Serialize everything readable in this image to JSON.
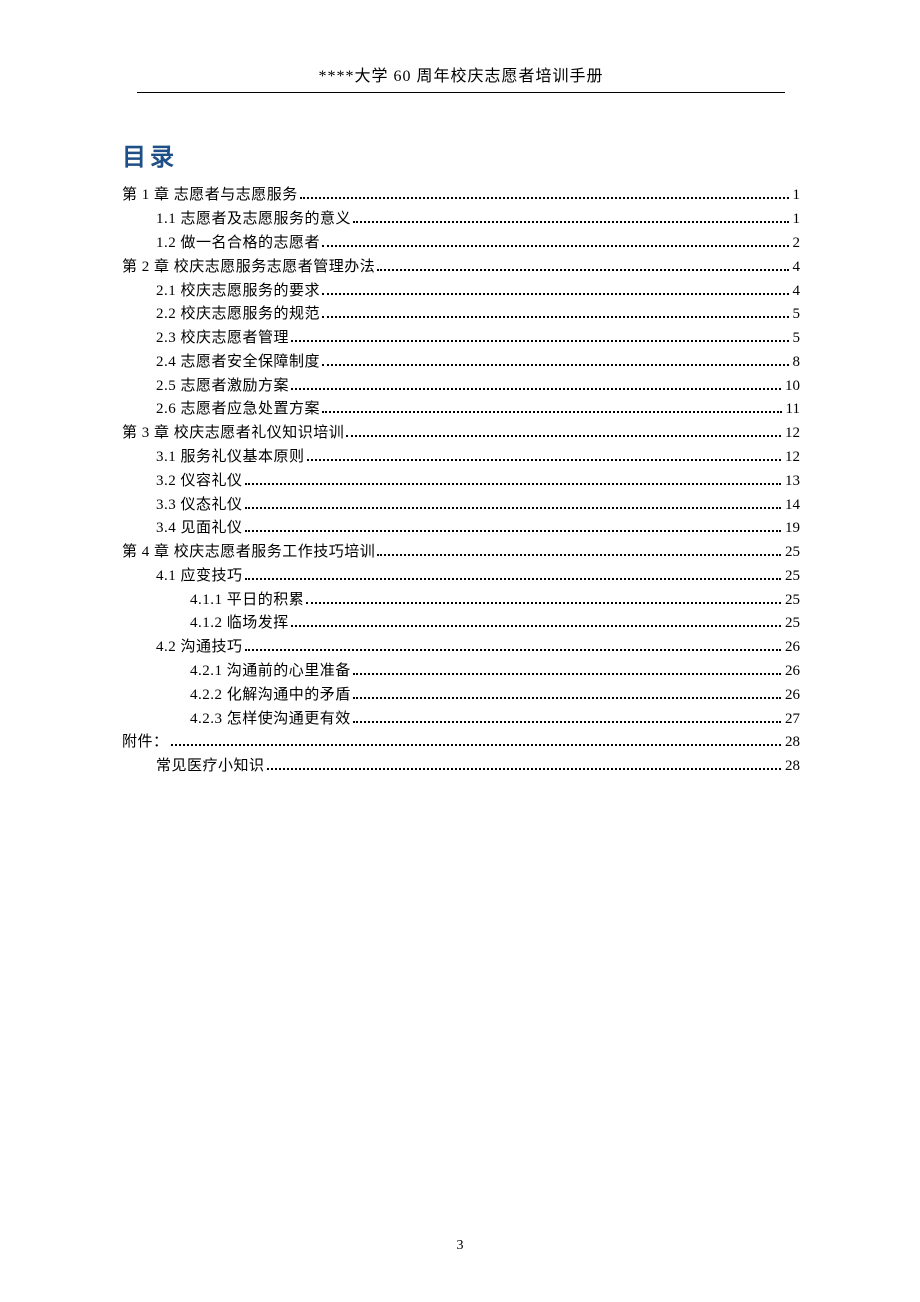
{
  "header": {
    "running_title": "****大学 60 周年校庆志愿者培训手册"
  },
  "toc": {
    "title": "目录",
    "entries": [
      {
        "level": 0,
        "label": "第 1 章  志愿者与志愿服务",
        "page": "1"
      },
      {
        "level": 1,
        "label": "1.1  志愿者及志愿服务的意义",
        "page": "1"
      },
      {
        "level": 1,
        "label": "1.2  做一名合格的志愿者",
        "page": "2"
      },
      {
        "level": 0,
        "label": "第 2 章  校庆志愿服务志愿者管理办法",
        "page": "4"
      },
      {
        "level": 1,
        "label": "2.1  校庆志愿服务的要求",
        "page": "4"
      },
      {
        "level": 1,
        "label": "2.2  校庆志愿服务的规范",
        "page": "5"
      },
      {
        "level": 1,
        "label": "2.3  校庆志愿者管理",
        "page": "5"
      },
      {
        "level": 1,
        "label": "2.4  志愿者安全保障制度",
        "page": "8"
      },
      {
        "level": 1,
        "label": "2.5  志愿者激励方案",
        "page": "10"
      },
      {
        "level": 1,
        "label": "2.6  志愿者应急处置方案",
        "page": "11"
      },
      {
        "level": 0,
        "label": "第 3 章  校庆志愿者礼仪知识培训",
        "page": "12"
      },
      {
        "level": 1,
        "label": "3.1  服务礼仪基本原则",
        "page": "12"
      },
      {
        "level": 1,
        "label": "3.2  仪容礼仪",
        "page": "13"
      },
      {
        "level": 1,
        "label": "3.3  仪态礼仪",
        "page": "14"
      },
      {
        "level": 1,
        "label": "3.4  见面礼仪",
        "page": "19"
      },
      {
        "level": 0,
        "label": "第 4 章  校庆志愿者服务工作技巧培训",
        "page": "25"
      },
      {
        "level": 1,
        "label": "4.1  应变技巧",
        "page": "25"
      },
      {
        "level": 2,
        "label": "4.1.1  平日的积累",
        "page": "25"
      },
      {
        "level": 2,
        "label": "4.1.2  临场发挥",
        "page": "25"
      },
      {
        "level": 1,
        "label": "4.2  沟通技巧",
        "page": "26"
      },
      {
        "level": 2,
        "label": "4.2.1  沟通前的心里准备",
        "page": "26"
      },
      {
        "level": 2,
        "label": "4.2.2  化解沟通中的矛盾",
        "page": "26"
      },
      {
        "level": 2,
        "label": "4.2.3  怎样使沟通更有效",
        "page": "27"
      },
      {
        "level": 0,
        "label": "附件：",
        "page": "28"
      },
      {
        "level": 1,
        "label": "常见医疗小知识",
        "page": "28"
      }
    ]
  },
  "footer": {
    "page_number": "3"
  }
}
